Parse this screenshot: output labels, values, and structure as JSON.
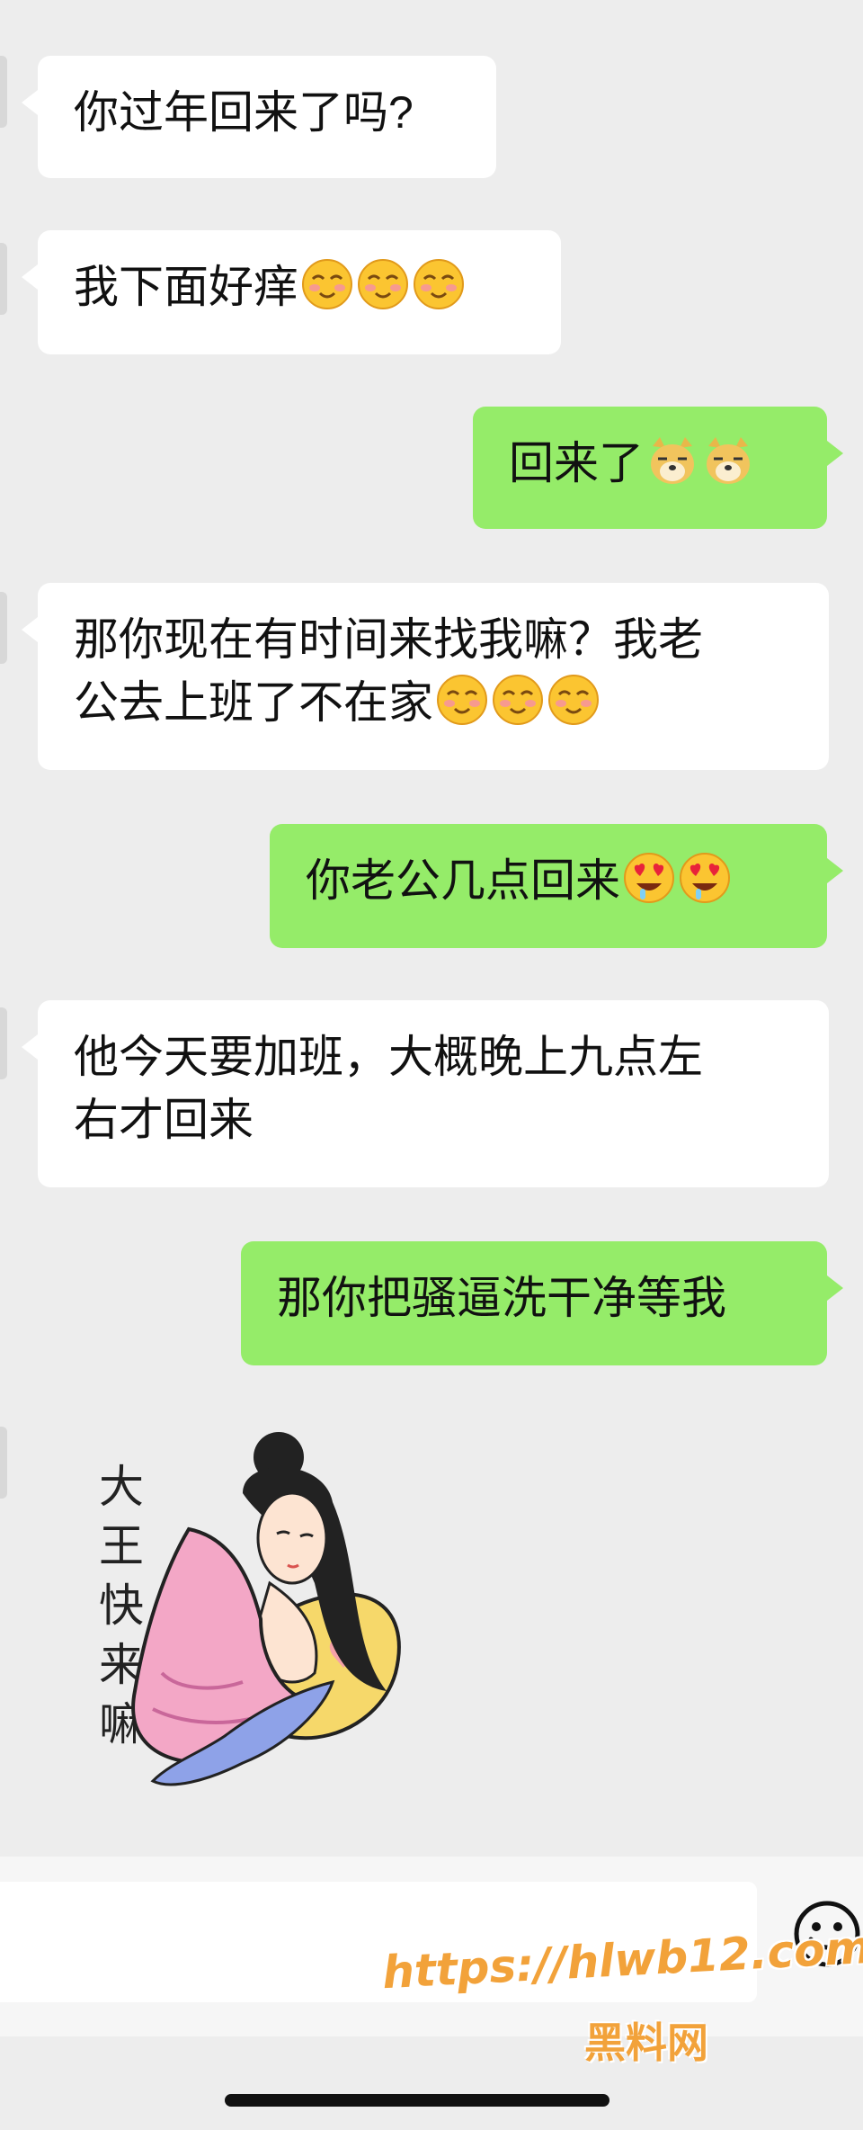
{
  "messages": [
    {
      "side": "in",
      "text": "你过年回来了吗?",
      "emojis": []
    },
    {
      "side": "in",
      "text": "我下面好痒",
      "emojis": [
        "blush-smile",
        "blush-smile",
        "blush-smile"
      ]
    },
    {
      "side": "out",
      "text": "回来了",
      "emojis": [
        "doge",
        "doge"
      ]
    },
    {
      "side": "in",
      "text": "那你现在有时间来找我嘛？我老",
      "text2": "公去上班了不在家",
      "emojis": [
        "blush-smile",
        "blush-smile",
        "blush-smile"
      ]
    },
    {
      "side": "out",
      "text": "你老公几点回来",
      "emojis": [
        "heart-eyes",
        "heart-eyes"
      ]
    },
    {
      "side": "in",
      "text": "他今天要加班，大概晚上九点左",
      "text2": "右才回来",
      "emojis": []
    },
    {
      "side": "out",
      "text": "那你把骚逼洗干净等我",
      "emojis": []
    }
  ],
  "sticker": {
    "text_lines": [
      "大",
      "王",
      "快",
      "来",
      "嘛"
    ],
    "icon": "cartoon-girl-sticker"
  },
  "input": {
    "value": "",
    "placeholder": ""
  },
  "emoji_button_icon": "smiley-icon",
  "watermark": {
    "url": "https://hlwb12.com",
    "name": "黑料网"
  },
  "colors": {
    "background": "#ededed",
    "incoming": "#ffffff",
    "outgoing": "#95ec69",
    "watermark": "#f2a23a"
  }
}
